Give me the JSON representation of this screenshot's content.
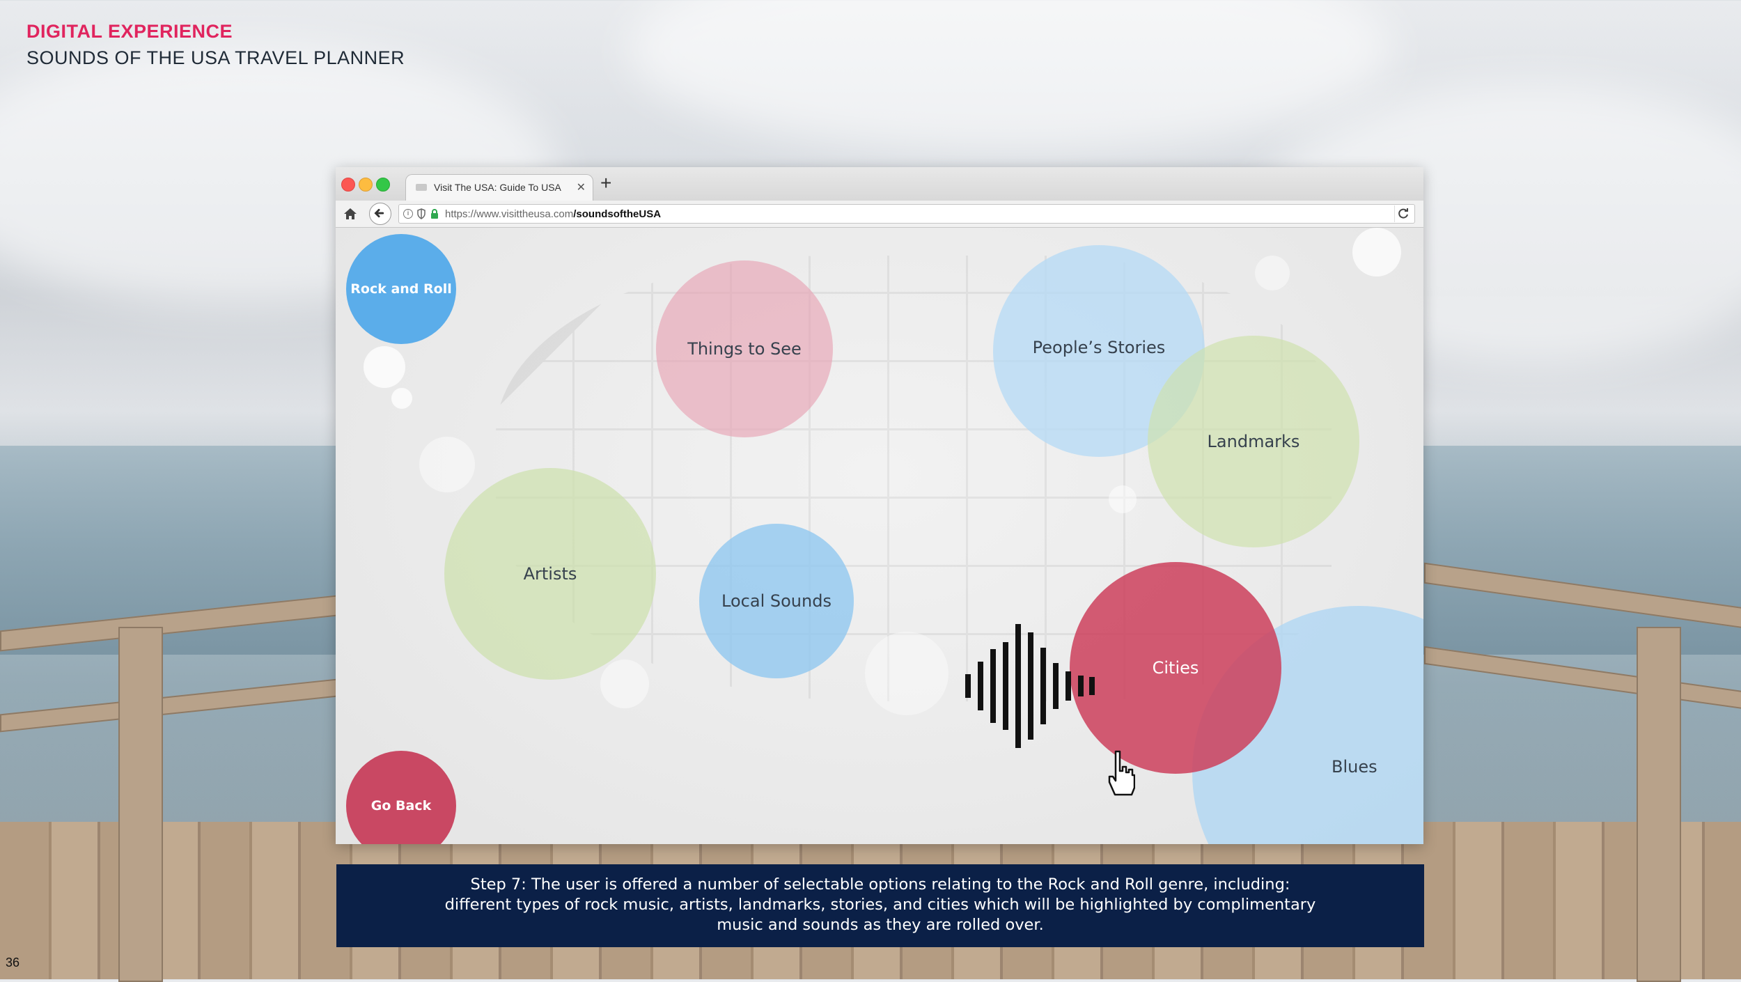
{
  "header": {
    "kicker": "DIGITAL EXPERIENCE",
    "title": "SOUNDS OF THE USA TRAVEL PLANNER"
  },
  "page_number": "36",
  "browser": {
    "tab_title": "Visit The USA: Guide To USA",
    "new_tab_symbol": "+",
    "tab_close_symbol": "✕",
    "url_prefix": "https://www.visittheusa.com",
    "url_path": "/soundsoftheUSA",
    "icons": [
      "home-icon",
      "back-arrow-icon",
      "info-icon",
      "shield-icon",
      "lock-icon",
      "reload-icon"
    ]
  },
  "bubbles": {
    "rock_and_roll": "Rock and Roll",
    "things_to_see": "Things to See",
    "peoples_stories": "People’s Stories",
    "landmarks": "Landmarks",
    "artists": "Artists",
    "local_sounds": "Local Sounds",
    "cities": "Cities",
    "blues": "Blues",
    "go_back": "Go Back"
  },
  "caption": {
    "line1": "Step 7: The user is offered a number of selectable options relating to the Rock and Roll genre, including:",
    "line2": "different types of rock music, artists, landmarks, stories, and cities which will be highlighted by complimentary",
    "line3": "music and sounds as they are rolled over."
  },
  "colors": {
    "accent_pink": "#e0245e",
    "rock_blue": "#5badea",
    "cities_red": "#cc405c",
    "go_back_red": "#c94863",
    "caption_navy": "#0b2047"
  }
}
